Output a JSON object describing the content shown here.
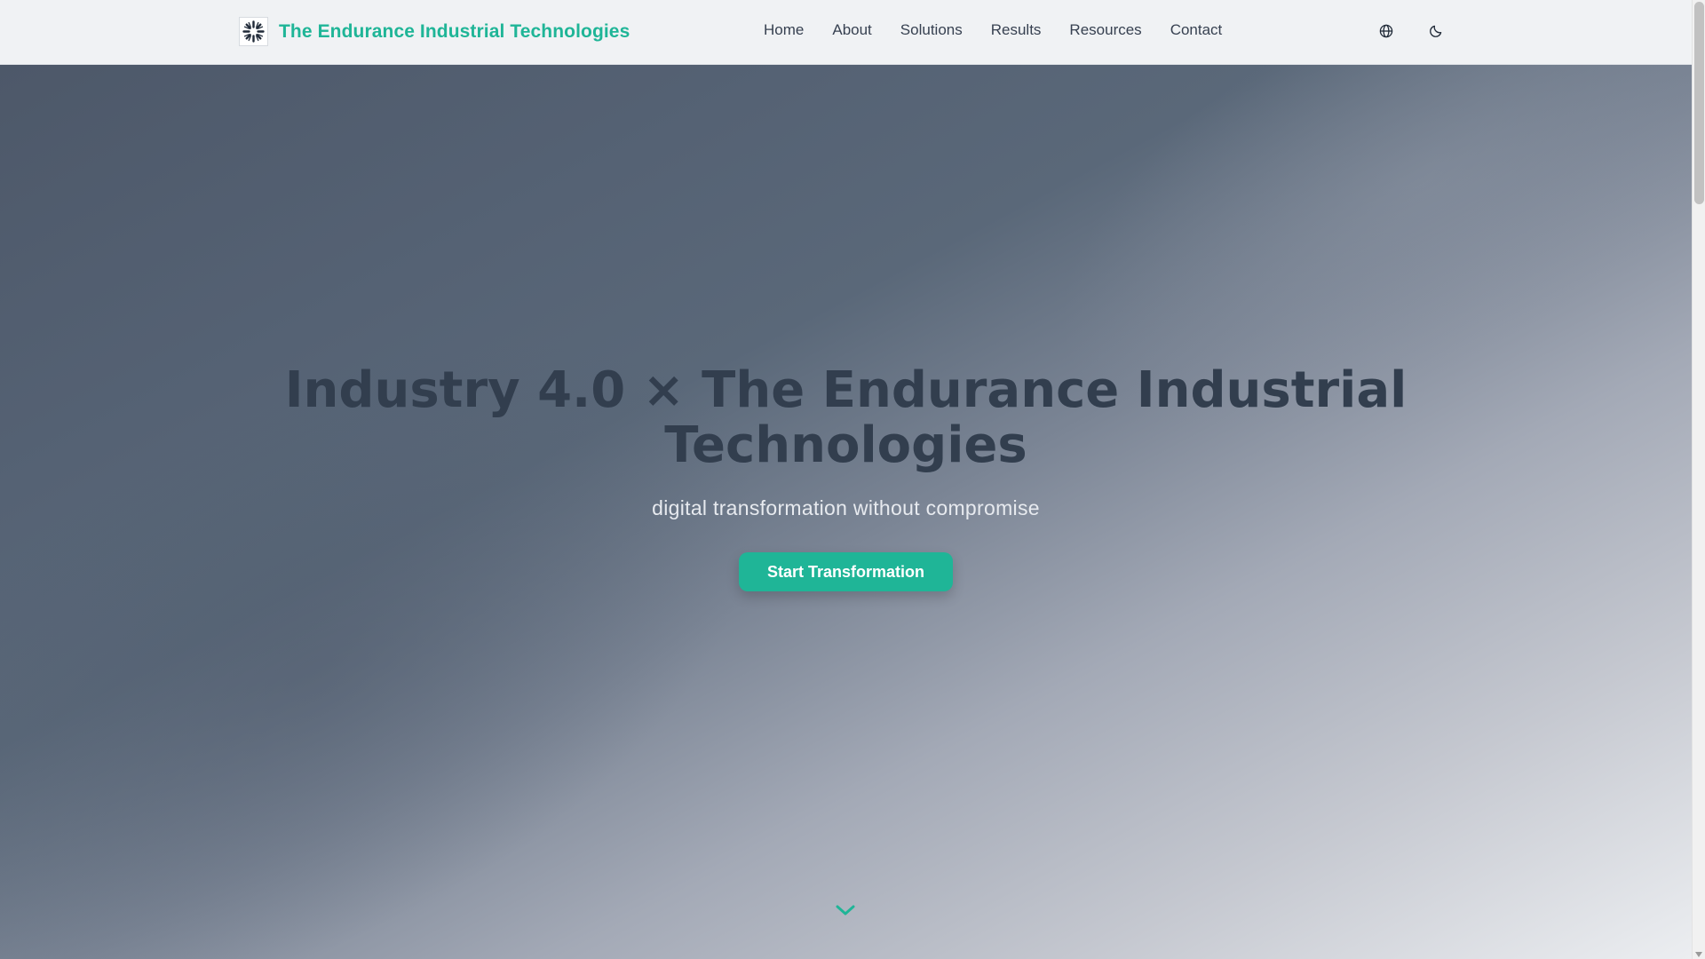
{
  "header": {
    "brand_name": "The Endurance Industrial Technologies",
    "logo_icon": "snowflake-burst-icon",
    "nav": [
      {
        "label": "Home"
      },
      {
        "label": "About"
      },
      {
        "label": "Solutions"
      },
      {
        "label": "Results"
      },
      {
        "label": "Resources"
      },
      {
        "label": "Contact"
      }
    ],
    "language_icon": "globe-icon",
    "theme_icon": "moon-icon"
  },
  "hero": {
    "title_line1": "Industry 4.0 × The Endurance Industrial",
    "title_line2": "Technologies",
    "subtitle": "digital transformation without compromise",
    "cta_label": "Start Transformation",
    "scroll_icon": "chevron-down-icon"
  },
  "colors": {
    "accent": "#1fb597",
    "header_bg": "#f0f2f4",
    "title": "#323e4e",
    "nav_text": "#374151"
  }
}
